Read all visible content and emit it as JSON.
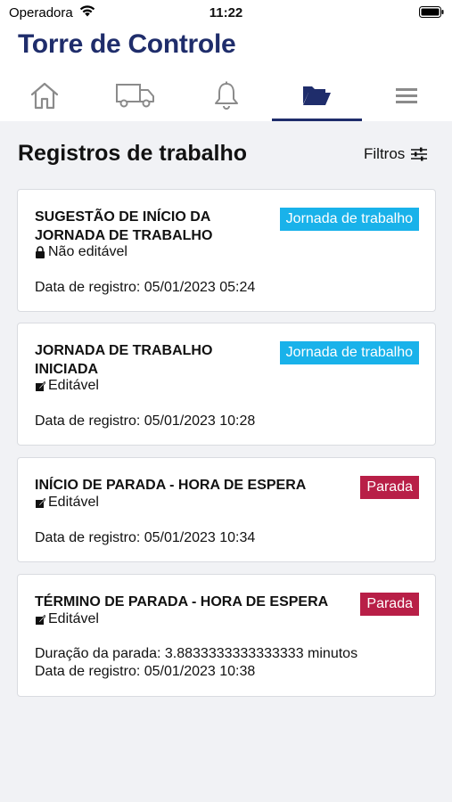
{
  "status_bar": {
    "carrier": "Operadora",
    "time": "11:22"
  },
  "app": {
    "title": "Torre de Controle"
  },
  "nav": {
    "tabs": [
      {
        "icon": "home-icon"
      },
      {
        "icon": "truck-icon"
      },
      {
        "icon": "bell-icon"
      },
      {
        "icon": "folder-open-icon",
        "active": true
      },
      {
        "icon": "menu-icon"
      }
    ],
    "accent": "#1f2d6b"
  },
  "page": {
    "title": "Registros de trabalho",
    "filters_label": "Filtros"
  },
  "colors": {
    "jornada_badge": "#19b2ea",
    "parada_badge": "#b81f47",
    "background": "#f1f2f5"
  },
  "records": [
    {
      "title": "SUGESTÃO DE INÍCIO DA JORNADA DE TRABALHO",
      "badge": "Jornada de trabalho",
      "edit_status": "Não editável",
      "edit_icon": "lock-icon",
      "registered_at": "Data de registro: 05/01/2023 05:24"
    },
    {
      "title": "JORNADA DE TRABALHO INICIADA",
      "badge": "Jornada de trabalho",
      "edit_status": "Editável",
      "edit_icon": "edit-icon",
      "registered_at": "Data de registro: 05/01/2023 10:28"
    },
    {
      "title": "INÍCIO DE PARADA - HORA DE ESPERA",
      "badge": "Parada",
      "edit_status": "Editável",
      "edit_icon": "edit-icon",
      "registered_at": "Data de registro: 05/01/2023 10:34"
    },
    {
      "title": "TÉRMINO DE PARADA - HORA DE ESPERA",
      "badge": "Parada",
      "edit_status": "Editável",
      "edit_icon": "edit-icon",
      "duration": "Duração da parada: 3.8833333333333333 minutos",
      "registered_at": "Data de registro: 05/01/2023 10:38"
    }
  ]
}
